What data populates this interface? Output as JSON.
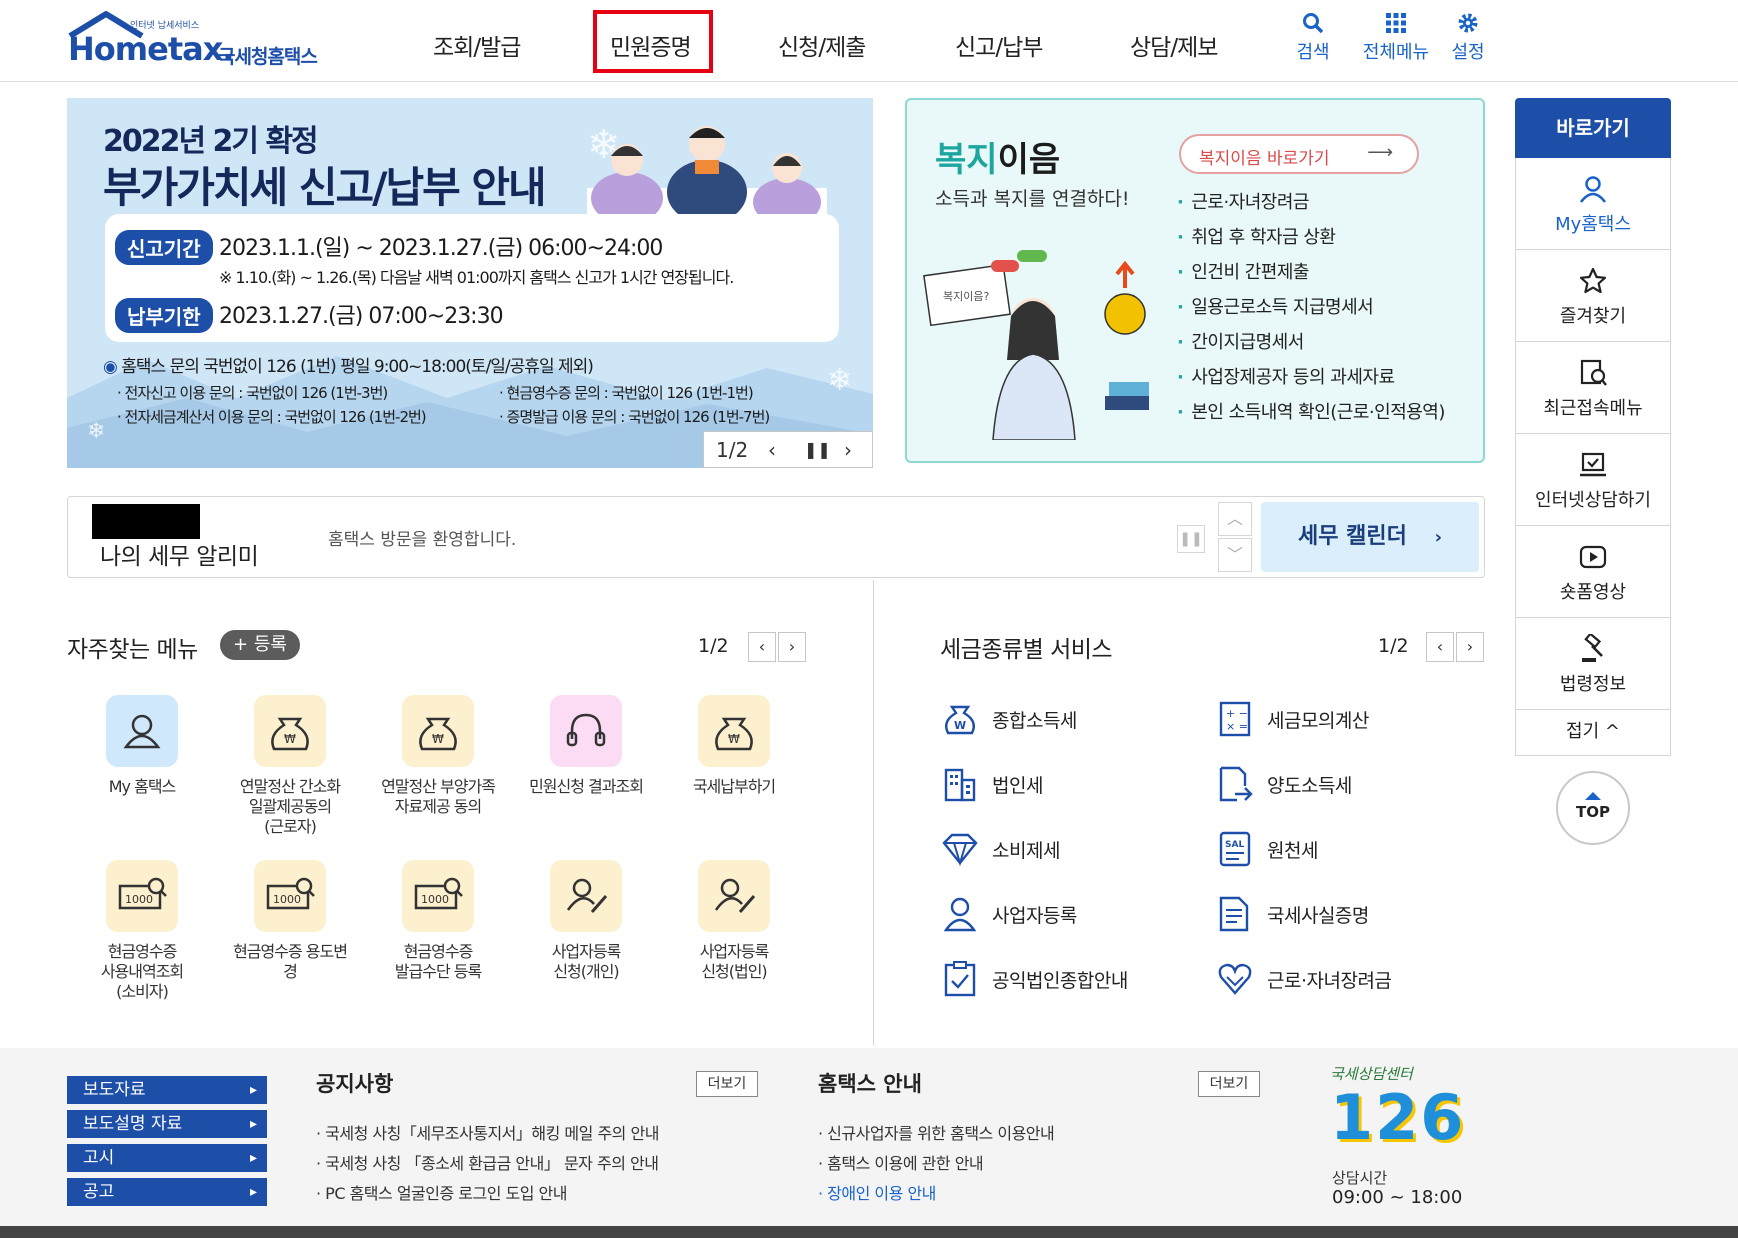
{
  "header": {
    "logo_small": "인터넷 납세서비스",
    "logo_main": "Hometax.",
    "logo_sub": "국세청홈택스",
    "nav": [
      "조회/발급",
      "민원증명",
      "신청/제출",
      "신고/납부",
      "상담/제보"
    ],
    "highlighted_nav": "민원증명",
    "util": [
      {
        "label": "검색",
        "icon": "search-icon"
      },
      {
        "label": "전체메뉴",
        "icon": "grid-menu-icon"
      },
      {
        "label": "설정",
        "icon": "gear-icon"
      }
    ],
    "accent_color": "#1e4fa8",
    "highlight_color": "#e60012"
  },
  "banner": {
    "heading_small": "2022년 2기 확정",
    "heading_big": "부가가치세 신고/납부 안내",
    "period_label": "신고기간",
    "period_value": "2023.1.1.(일) ~ 2023.1.27.(금) 06:00~24:00",
    "period_note": "※ 1.10.(화) ~ 1.26.(목) 다음날 새벽 01:00까지 홈택스 신고가 1시간 연장됩니다.",
    "deadline_label": "납부기한",
    "deadline_value": "2023.1.27.(금) 07:00~23:30",
    "contact_main": "홈택스 문의 국번없이 126 (1번) 평일 9:00~18:00(토/일/공휴일 제외)",
    "contact_1": "· 전자신고 이용 문의 : 국번없이 126 (1번-3번)",
    "contact_2": "· 현금영수증 문의 : 국번없이 126 (1번-1번)",
    "contact_3": "· 전자세금계산서 이용 문의 : 국번없이 126 (1번-2번)",
    "contact_4": "· 증명발급 이용 문의 : 국번없이 126 (1번-7번)",
    "pager": "1/2"
  },
  "welfare": {
    "title_1": "복지",
    "title_2": "이음",
    "subtitle": "소득과 복지를 연결하다!",
    "button": "복지이음 바로가기",
    "bubble": "복지이음?",
    "items": [
      "근로·자녀장려금",
      "취업 후 학자금 상환",
      "인건비 간편제출",
      "일용근로소득 지급명세서",
      "간이지급명세서",
      "사업장제공자 등의 과세자료",
      "본인 소득내역 확인(근로·인적용역)"
    ]
  },
  "quickbar": {
    "title": "바로가기",
    "items": [
      {
        "label": "My홈택스",
        "icon": "user-icon"
      },
      {
        "label": "즐겨찾기",
        "icon": "star-icon"
      },
      {
        "label": "최근접속메뉴",
        "icon": "recent-menu-icon"
      },
      {
        "label": "인터넷상담하기",
        "icon": "laptop-check-icon"
      },
      {
        "label": "숏폼영상",
        "icon": "play-icon"
      },
      {
        "label": "법령정보",
        "icon": "gavel-icon"
      }
    ],
    "fold": "접기 ^",
    "top": "TOP"
  },
  "alarm": {
    "title": "나의 세무 알리미",
    "message": "홈택스 방문을 환영합니다.",
    "calendar": "세무 캘린더"
  },
  "freq_menu": {
    "title": "자주찾는 메뉴",
    "register": "+ 등록",
    "pager": "1/2",
    "items": [
      {
        "label": "My 홈택스",
        "icon": "user-icon",
        "bg": "#cfe8fb"
      },
      {
        "label": "연말정산 간소화\n일괄제공동의\n(근로자)",
        "icon": "money-bag-icon",
        "bg": "#fdf0cf"
      },
      {
        "label": "연말정산 부양가족\n자료제공 동의",
        "icon": "money-bag-icon",
        "bg": "#fdf0cf"
      },
      {
        "label": "민원신청 결과조회",
        "icon": "headset-icon",
        "bg": "#fbdcf4"
      },
      {
        "label": "국세납부하기",
        "icon": "money-bag-icon",
        "bg": "#fdf0cf"
      },
      {
        "label": "현금영수증\n사용내역조회\n(소비자)",
        "icon": "receipt-search-icon",
        "bg": "#fdf0cf"
      },
      {
        "label": "현금영수증 용도변\n경",
        "icon": "receipt-search-icon",
        "bg": "#fdf0cf"
      },
      {
        "label": "현금영수증\n발급수단 등록",
        "icon": "receipt-search-icon",
        "bg": "#fdf0cf"
      },
      {
        "label": "사업자등록\n신청(개인)",
        "icon": "user-edit-icon",
        "bg": "#fdf0cf"
      },
      {
        "label": "사업자등록\n신청(법인)",
        "icon": "user-edit-icon",
        "bg": "#fdf0cf"
      }
    ]
  },
  "tax_types": {
    "title": "세금종류별 서비스",
    "pager": "1/2",
    "items": [
      {
        "label": "종합소득세",
        "icon": "money-w-icon"
      },
      {
        "label": "세금모의계산",
        "icon": "calculator-icon"
      },
      {
        "label": "법인세",
        "icon": "building-icon"
      },
      {
        "label": "양도소득세",
        "icon": "document-transfer-icon"
      },
      {
        "label": "소비제세",
        "icon": "diamond-icon"
      },
      {
        "label": "원천세",
        "icon": "receipt-icon"
      },
      {
        "label": "사업자등록",
        "icon": "user-icon"
      },
      {
        "label": "국세사실증명",
        "icon": "document-icon"
      },
      {
        "label": "공익법인종합안내",
        "icon": "clipboard-check-icon"
      },
      {
        "label": "근로·자녀장려금",
        "icon": "heart-hands-icon"
      }
    ]
  },
  "footer": {
    "links": [
      "보도자료",
      "보도설명 자료",
      "고시",
      "공고"
    ],
    "notice_title": "공지사항",
    "notice_more": "더보기",
    "notices": [
      "국세청 사칭「세무조사통지서」해킹 메일 주의 안내",
      "국세청 사칭 「종소세 환급금 안내」 문자 주의 안내",
      "PC 홈택스 얼굴인증 로그인 도입 안내"
    ],
    "guide_title": "홈택스 안내",
    "guide_more": "더보기",
    "guides": [
      "신규사업자를 위한 홈택스 이용안내",
      "홈택스 이용에 관한 안내",
      "장애인 이용 안내"
    ],
    "center_title": "국세상담센터",
    "center_number": "126",
    "center_hours_label": "상담시간",
    "center_hours": "09:00 ~ 18:00"
  }
}
